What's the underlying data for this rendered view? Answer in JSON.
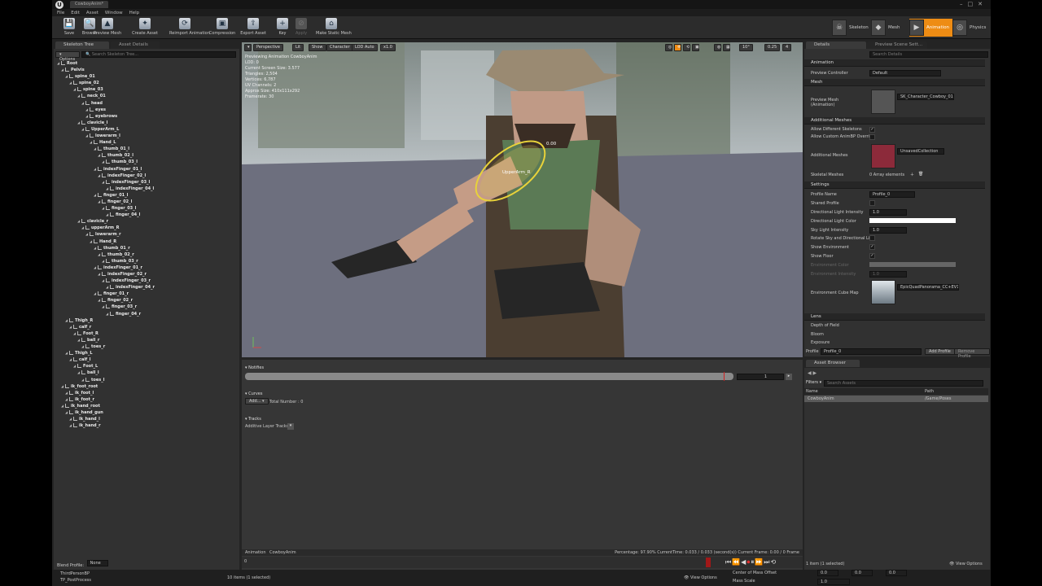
{
  "window": {
    "tab_title": "CowboyAnim*",
    "logo_glyph": "U"
  },
  "menu": [
    "File",
    "Edit",
    "Asset",
    "Window",
    "Help"
  ],
  "toolbar": {
    "buttons": [
      {
        "label": "Save",
        "icon": "save-icon",
        "glyph": "💾",
        "enabled": true
      },
      {
        "label": "Browse",
        "icon": "search-icon",
        "glyph": "🔍",
        "enabled": true
      },
      {
        "label": "Preview Mesh",
        "icon": "mesh-icon",
        "glyph": "▲",
        "enabled": true
      },
      {
        "label": "Create Asset",
        "icon": "create-asset-icon",
        "glyph": "✦",
        "enabled": true
      },
      {
        "label": "Reimport Animation",
        "icon": "reimport-icon",
        "glyph": "⟳",
        "enabled": true
      },
      {
        "label": "Compression",
        "icon": "compression-icon",
        "glyph": "▣",
        "enabled": true
      },
      {
        "label": "Export Asset",
        "icon": "export-icon",
        "glyph": "⇪",
        "enabled": true
      },
      {
        "label": "Key",
        "icon": "plus-icon",
        "glyph": "+",
        "enabled": true
      },
      {
        "label": "Apply",
        "icon": "apply-icon",
        "glyph": "⊘",
        "enabled": false
      },
      {
        "label": "Make Static Mesh",
        "icon": "static-mesh-icon",
        "glyph": "⌂",
        "enabled": true
      }
    ],
    "modes": [
      {
        "label": "Skeleton",
        "glyph": "☠",
        "active": false
      },
      {
        "label": "Mesh",
        "glyph": "◆",
        "active": false
      },
      {
        "label": "Animation",
        "glyph": "▶",
        "active": true
      },
      {
        "label": "Physics",
        "glyph": "◎",
        "active": false
      }
    ]
  },
  "left": {
    "tabs": [
      "Skeleton Tree",
      "Asset Details"
    ],
    "options_label": "Options",
    "search_placeholder": "Search Skeleton Tree...",
    "selected": "upperarm_R",
    "bones": [
      [
        "Root",
        0
      ],
      [
        "Pelvis",
        1
      ],
      [
        "spine_01",
        2
      ],
      [
        "spine_02",
        3
      ],
      [
        "spine_03",
        4
      ],
      [
        "neck_01",
        5
      ],
      [
        "head",
        6
      ],
      [
        "eyes",
        7
      ],
      [
        "eyebrows",
        7
      ],
      [
        "clavicle_l",
        5
      ],
      [
        "UpperArm_L",
        6
      ],
      [
        "lowerarm_l",
        7
      ],
      [
        "Hand_L",
        8
      ],
      [
        "thumb_01_l",
        9
      ],
      [
        "thumb_02_l",
        10
      ],
      [
        "thumb_03_l",
        11
      ],
      [
        "indexFinger_01_l",
        9
      ],
      [
        "indexFinger_02_l",
        10
      ],
      [
        "indexFinger_03_l",
        11
      ],
      [
        "indexFinger_04_l",
        12
      ],
      [
        "finger_01_l",
        9
      ],
      [
        "finger_02_l",
        10
      ],
      [
        "finger_03_l",
        11
      ],
      [
        "finger_04_l",
        12
      ],
      [
        "clavicle_r",
        5
      ],
      [
        "upperArm_R",
        6
      ],
      [
        "lowerarm_r",
        7
      ],
      [
        "Hand_R",
        8
      ],
      [
        "thumb_01_r",
        9
      ],
      [
        "thumb_02_r",
        10
      ],
      [
        "thumb_03_r",
        11
      ],
      [
        "indexFinger_01_r",
        9
      ],
      [
        "indexFinger_02_r",
        10
      ],
      [
        "indexFinger_03_r",
        11
      ],
      [
        "indexFinger_04_r",
        12
      ],
      [
        "finger_01_r",
        9
      ],
      [
        "finger_02_r",
        10
      ],
      [
        "finger_03_r",
        11
      ],
      [
        "finger_04_r",
        12
      ],
      [
        "Thigh_R",
        2
      ],
      [
        "calf_r",
        3
      ],
      [
        "Foot_R",
        4
      ],
      [
        "ball_r",
        5
      ],
      [
        "toes_r",
        6
      ],
      [
        "Thigh_L",
        2
      ],
      [
        "calf_l",
        3
      ],
      [
        "Foot_L",
        4
      ],
      [
        "ball_l",
        5
      ],
      [
        "toes_l",
        6
      ],
      [
        "ik_foot_root",
        1
      ],
      [
        "ik_foot_l",
        2
      ],
      [
        "ik_foot_r",
        2
      ],
      [
        "ik_hand_root",
        1
      ],
      [
        "ik_hand_gun",
        2
      ],
      [
        "ik_hand_l",
        3
      ],
      [
        "ik_hand_r",
        3
      ]
    ],
    "blend_profile_label": "Blend Profile:",
    "blend_profile_value": "None"
  },
  "viewport": {
    "buttons": [
      "Perspective",
      "Lit",
      "Show",
      "Character",
      "LOD Auto",
      "x1.0"
    ],
    "right_values": [
      "10°",
      "0.25",
      "4"
    ],
    "info": [
      "Previewing Animation CowboyAnim",
      "LOD: 0",
      "Current Screen Size: 3.577",
      "Triangles: 2,504",
      "Vertices: 6,787",
      "UV Channels: 2",
      "Approx Size: 410x111x292",
      "Framerate: 30"
    ],
    "bone_label": "UpperArm_R",
    "gizmo_value": "0.00"
  },
  "sequencer": {
    "notifies": "Notifies",
    "notify_track_value": "1",
    "curves": "Curves",
    "add_label": "Add...",
    "total_number": "Total Number : 0",
    "tracks": "Tracks",
    "additive_label": "Additive Layer Tracks",
    "footer_animation": "Animation",
    "footer_name": "CowboyAnim",
    "status": "Percentage:  97.90% CurrentTime:  0.033 / 0.033 (second(s)) Current Frame:  0.00 / 0 Frame",
    "timeline_zero": "0"
  },
  "details": {
    "tabs": [
      "Details",
      "Preview Scene Sett..."
    ],
    "search_placeholder": "Search Details",
    "animation_section": "Animation",
    "preview_controller_label": "Preview Controller",
    "preview_controller_value": "Default",
    "mesh_section": "Mesh",
    "preview_mesh_label": "Preview Mesh",
    "preview_mesh_sub": "(Animation)",
    "preview_mesh_value": "SK_Character_Cowboy_01",
    "additional_section": "Additional Meshes",
    "allow_diff_label": "Allow Different Skeletons",
    "allow_custom_label": "Allow Custom AnimBP Overrid",
    "additional_meshes_label": "Additional Meshes",
    "additional_value": "UnsavedCollection",
    "skeletal_label": "Skeletal Meshes",
    "skeletal_value": "0 Array elements",
    "settings_section": "Settings",
    "profile_name_label": "Profile Name",
    "profile_name_value": "Profile_0",
    "shared_label": "Shared Profile",
    "dir_int_label": "Directional Light Intensity",
    "dir_int_value": "1.0",
    "dir_color_label": "Directional Light Color",
    "sky_label": "Sky Light Intensity",
    "sky_value": "1.0",
    "rotate_label": "Rotate Sky and Directional Ligh",
    "show_env_label": "Show Environment",
    "show_floor_label": "Show Floor",
    "env_color_label": "Environment Color",
    "env_int_label": "Environment Intensity",
    "env_int_value": "1.0",
    "cubemap_label": "Environment Cube Map",
    "cubemap_value": "EpicQuadPanorama_CC+EV1",
    "lens_section": "Lens",
    "dof_label": "Depth of Field",
    "bloom_label": "Bloom",
    "exposure_label": "Exposure",
    "profile_label": "Profile",
    "profile_value": "Profile_0",
    "add_profile": "Add Profile",
    "remove_profile": "Remove Profile"
  },
  "asset_browser": {
    "tab": "Asset Browser",
    "filters": "Filters",
    "search_placeholder": "Search Assets",
    "col_name": "Name",
    "col_path": "Path",
    "row_name": "CowboyAnim",
    "row_path": "/Game/Poses",
    "status": "1 item (1 selected)",
    "view_options": "View Options"
  },
  "bottom": {
    "left_a": "ThirdPersonBP",
    "left_b": "TP_PostProcess",
    "items": "10 items (1 selected)",
    "view_options": "View Options",
    "center_of_mass": "Center of Mass Offset",
    "mass_scale": "Mass Scale",
    "mass_value": "1.0",
    "offset_values": [
      "0.0",
      "0.0",
      "0.0"
    ]
  },
  "colors": {
    "accent": "#ee8c14",
    "selection_ring": "#e8d23a",
    "panel": "#313131"
  }
}
